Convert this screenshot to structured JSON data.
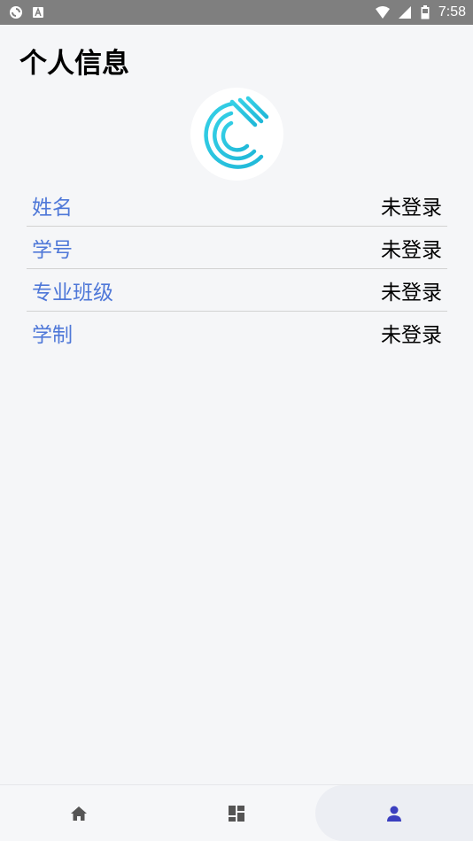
{
  "status_bar": {
    "time": "7:58",
    "left_icons": [
      "sync-icon",
      "notification-a-icon"
    ],
    "right_icons": [
      "wifi-icon",
      "signal-icon",
      "battery-icon"
    ]
  },
  "page": {
    "title": "个人信息"
  },
  "profile": {
    "avatar_icon": "app-logo-icon",
    "rows": [
      {
        "label": "姓名",
        "value": "未登录"
      },
      {
        "label": "学号",
        "value": "未登录"
      },
      {
        "label": "专业班级",
        "value": "未登录"
      },
      {
        "label": "学制",
        "value": "未登录"
      }
    ]
  },
  "bottom_nav": {
    "items": [
      {
        "icon": "home-icon",
        "active": false
      },
      {
        "icon": "dashboard-icon",
        "active": false
      },
      {
        "icon": "person-icon",
        "active": true
      }
    ]
  },
  "colors": {
    "label": "#4f78d8",
    "active_nav": "#3b3fbf",
    "inactive_nav": "#555555",
    "logo": "#2ec6e0"
  }
}
